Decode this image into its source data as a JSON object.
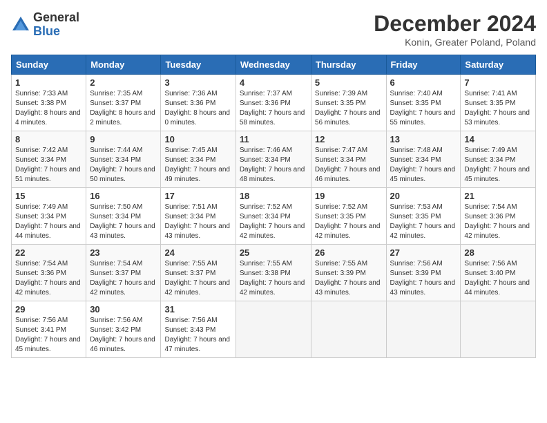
{
  "logo": {
    "general": "General",
    "blue": "Blue"
  },
  "title": "December 2024",
  "location": "Konin, Greater Poland, Poland",
  "days_of_week": [
    "Sunday",
    "Monday",
    "Tuesday",
    "Wednesday",
    "Thursday",
    "Friday",
    "Saturday"
  ],
  "weeks": [
    [
      {
        "day": "1",
        "sunrise": "7:33 AM",
        "sunset": "3:38 PM",
        "daylight": "8 hours and 4 minutes."
      },
      {
        "day": "2",
        "sunrise": "7:35 AM",
        "sunset": "3:37 PM",
        "daylight": "8 hours and 2 minutes."
      },
      {
        "day": "3",
        "sunrise": "7:36 AM",
        "sunset": "3:36 PM",
        "daylight": "8 hours and 0 minutes."
      },
      {
        "day": "4",
        "sunrise": "7:37 AM",
        "sunset": "3:36 PM",
        "daylight": "7 hours and 58 minutes."
      },
      {
        "day": "5",
        "sunrise": "7:39 AM",
        "sunset": "3:35 PM",
        "daylight": "7 hours and 56 minutes."
      },
      {
        "day": "6",
        "sunrise": "7:40 AM",
        "sunset": "3:35 PM",
        "daylight": "7 hours and 55 minutes."
      },
      {
        "day": "7",
        "sunrise": "7:41 AM",
        "sunset": "3:35 PM",
        "daylight": "7 hours and 53 minutes."
      }
    ],
    [
      {
        "day": "8",
        "sunrise": "7:42 AM",
        "sunset": "3:34 PM",
        "daylight": "7 hours and 51 minutes."
      },
      {
        "day": "9",
        "sunrise": "7:44 AM",
        "sunset": "3:34 PM",
        "daylight": "7 hours and 50 minutes."
      },
      {
        "day": "10",
        "sunrise": "7:45 AM",
        "sunset": "3:34 PM",
        "daylight": "7 hours and 49 minutes."
      },
      {
        "day": "11",
        "sunrise": "7:46 AM",
        "sunset": "3:34 PM",
        "daylight": "7 hours and 48 minutes."
      },
      {
        "day": "12",
        "sunrise": "7:47 AM",
        "sunset": "3:34 PM",
        "daylight": "7 hours and 46 minutes."
      },
      {
        "day": "13",
        "sunrise": "7:48 AM",
        "sunset": "3:34 PM",
        "daylight": "7 hours and 45 minutes."
      },
      {
        "day": "14",
        "sunrise": "7:49 AM",
        "sunset": "3:34 PM",
        "daylight": "7 hours and 45 minutes."
      }
    ],
    [
      {
        "day": "15",
        "sunrise": "7:49 AM",
        "sunset": "3:34 PM",
        "daylight": "7 hours and 44 minutes."
      },
      {
        "day": "16",
        "sunrise": "7:50 AM",
        "sunset": "3:34 PM",
        "daylight": "7 hours and 43 minutes."
      },
      {
        "day": "17",
        "sunrise": "7:51 AM",
        "sunset": "3:34 PM",
        "daylight": "7 hours and 43 minutes."
      },
      {
        "day": "18",
        "sunrise": "7:52 AM",
        "sunset": "3:34 PM",
        "daylight": "7 hours and 42 minutes."
      },
      {
        "day": "19",
        "sunrise": "7:52 AM",
        "sunset": "3:35 PM",
        "daylight": "7 hours and 42 minutes."
      },
      {
        "day": "20",
        "sunrise": "7:53 AM",
        "sunset": "3:35 PM",
        "daylight": "7 hours and 42 minutes."
      },
      {
        "day": "21",
        "sunrise": "7:54 AM",
        "sunset": "3:36 PM",
        "daylight": "7 hours and 42 minutes."
      }
    ],
    [
      {
        "day": "22",
        "sunrise": "7:54 AM",
        "sunset": "3:36 PM",
        "daylight": "7 hours and 42 minutes."
      },
      {
        "day": "23",
        "sunrise": "7:54 AM",
        "sunset": "3:37 PM",
        "daylight": "7 hours and 42 minutes."
      },
      {
        "day": "24",
        "sunrise": "7:55 AM",
        "sunset": "3:37 PM",
        "daylight": "7 hours and 42 minutes."
      },
      {
        "day": "25",
        "sunrise": "7:55 AM",
        "sunset": "3:38 PM",
        "daylight": "7 hours and 42 minutes."
      },
      {
        "day": "26",
        "sunrise": "7:55 AM",
        "sunset": "3:39 PM",
        "daylight": "7 hours and 43 minutes."
      },
      {
        "day": "27",
        "sunrise": "7:56 AM",
        "sunset": "3:39 PM",
        "daylight": "7 hours and 43 minutes."
      },
      {
        "day": "28",
        "sunrise": "7:56 AM",
        "sunset": "3:40 PM",
        "daylight": "7 hours and 44 minutes."
      }
    ],
    [
      {
        "day": "29",
        "sunrise": "7:56 AM",
        "sunset": "3:41 PM",
        "daylight": "7 hours and 45 minutes."
      },
      {
        "day": "30",
        "sunrise": "7:56 AM",
        "sunset": "3:42 PM",
        "daylight": "7 hours and 46 minutes."
      },
      {
        "day": "31",
        "sunrise": "7:56 AM",
        "sunset": "3:43 PM",
        "daylight": "7 hours and 47 minutes."
      },
      null,
      null,
      null,
      null
    ]
  ]
}
